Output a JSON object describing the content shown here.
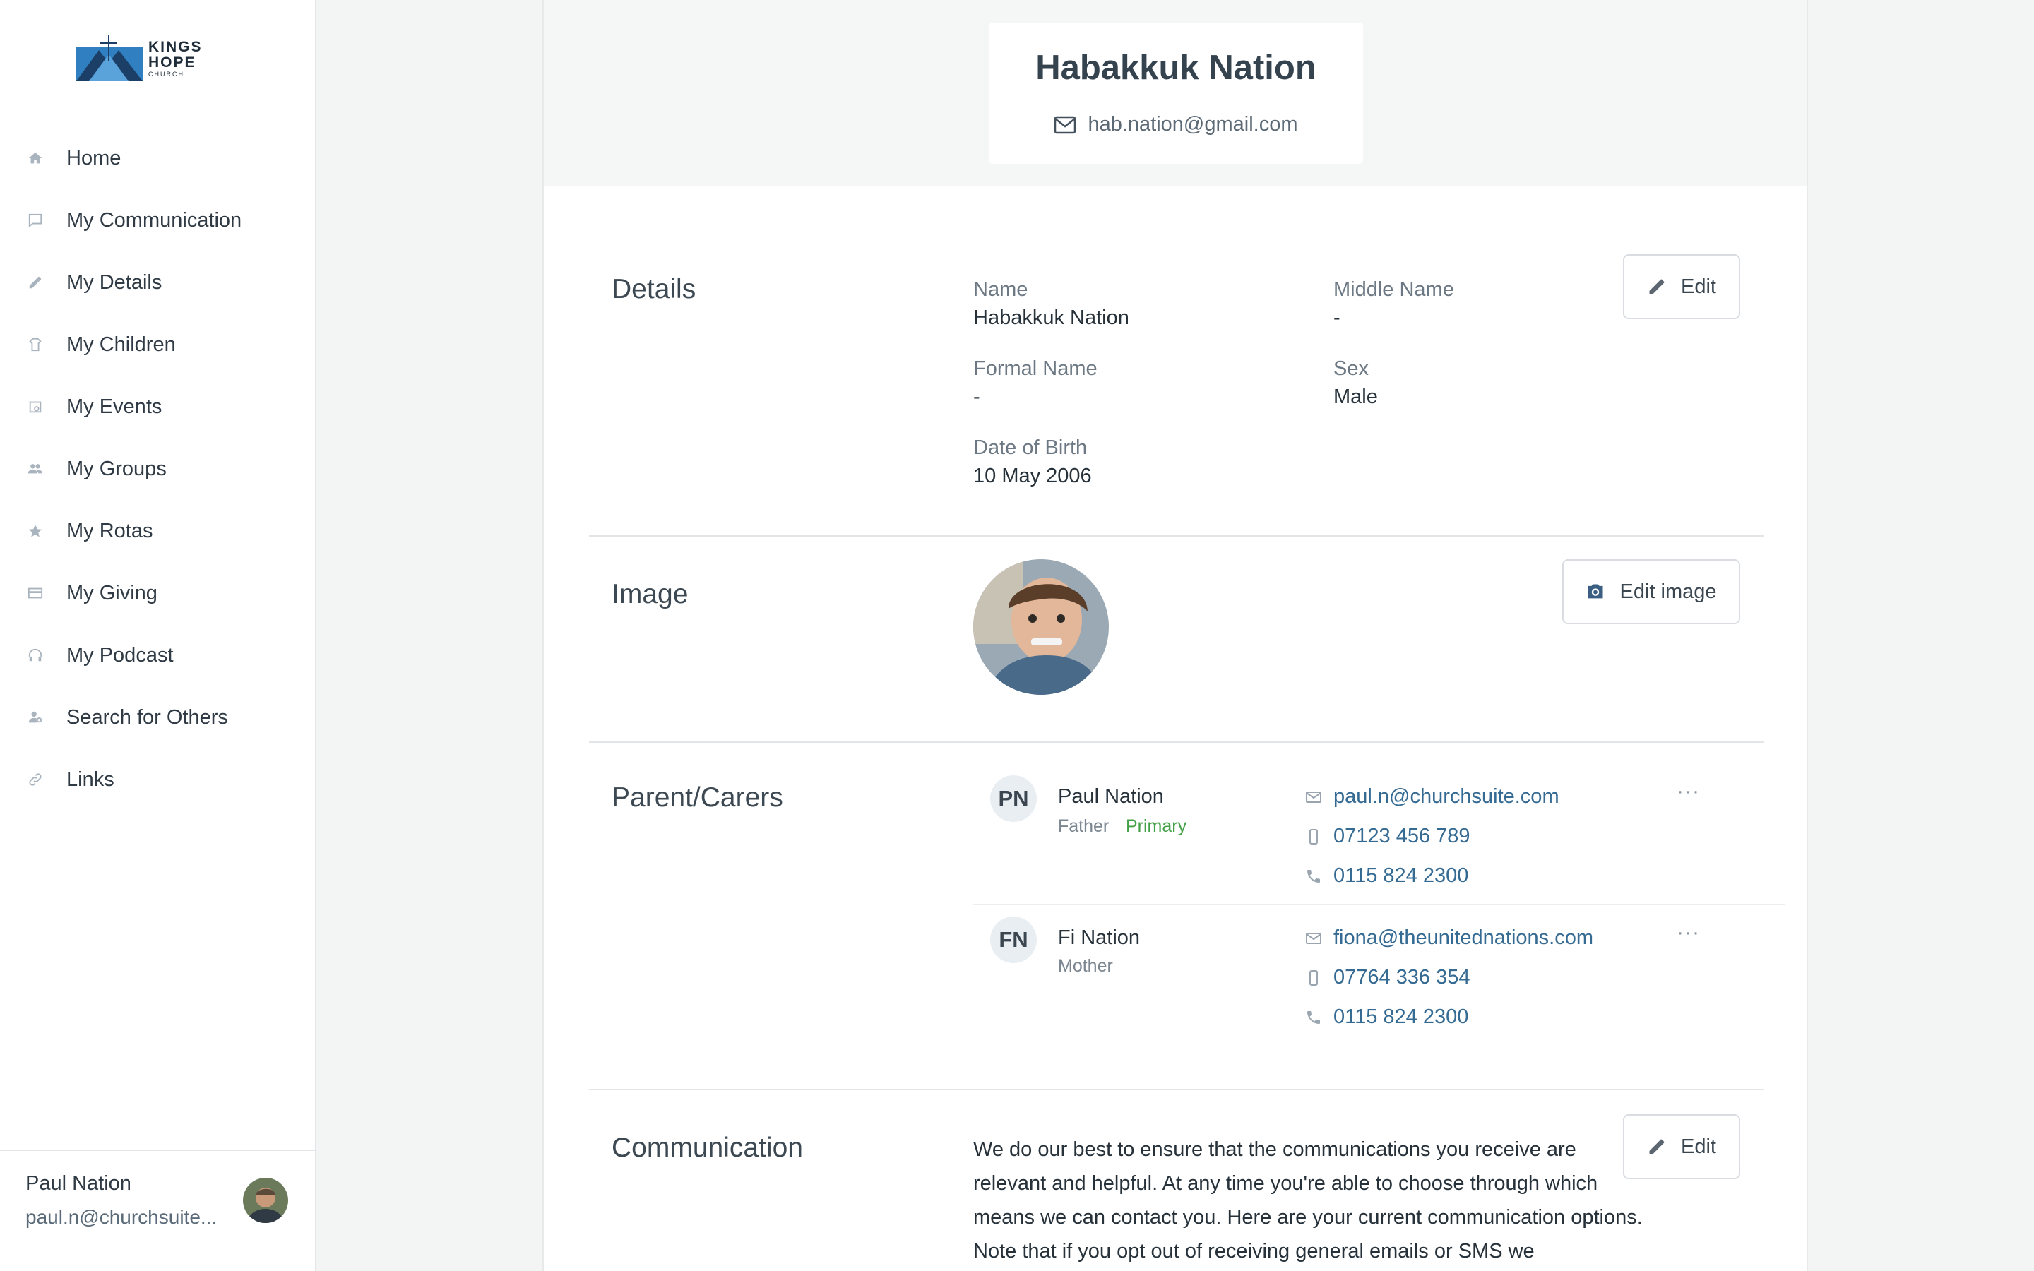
{
  "brand": {
    "name": "KINGS HOPE",
    "sub": "CHURCH"
  },
  "sidebar": {
    "items": [
      {
        "label": "Home",
        "icon": "home-icon"
      },
      {
        "label": "My Communication",
        "icon": "chat-icon"
      },
      {
        "label": "My Details",
        "icon": "pencil-icon"
      },
      {
        "label": "My Children",
        "icon": "child-icon"
      },
      {
        "label": "My Events",
        "icon": "calendar-icon"
      },
      {
        "label": "My Groups",
        "icon": "group-icon"
      },
      {
        "label": "My Rotas",
        "icon": "star-icon"
      },
      {
        "label": "My Giving",
        "icon": "card-icon"
      },
      {
        "label": "My Podcast",
        "icon": "headphones-icon"
      },
      {
        "label": "Search for Others",
        "icon": "person-search-icon"
      },
      {
        "label": "Links",
        "icon": "link-icon"
      }
    ],
    "user": {
      "name": "Paul Nation",
      "email": "paul.n@churchsuite..."
    }
  },
  "profile": {
    "name": "Habakkuk Nation",
    "email": "hab.nation@gmail.com"
  },
  "details": {
    "title": "Details",
    "edit_label": "Edit",
    "name_label": "Name",
    "name_value": "Habakkuk Nation",
    "middle_label": "Middle Name",
    "middle_value": "-",
    "formal_label": "Formal Name",
    "formal_value": "-",
    "sex_label": "Sex",
    "sex_value": "Male",
    "dob_label": "Date of Birth",
    "dob_value": "10 May 2006"
  },
  "image": {
    "title": "Image",
    "edit_label": "Edit image"
  },
  "parents": {
    "title": "Parent/Carers",
    "items": [
      {
        "initials": "PN",
        "name": "Paul Nation",
        "relation": "Father",
        "primary": "Primary",
        "email": "paul.n@churchsuite.com",
        "mobile": "07123 456 789",
        "phone": "0115 824 2300"
      },
      {
        "initials": "FN",
        "name": "Fi Nation",
        "relation": "Mother",
        "primary": "",
        "email": "fiona@theunitednations.com",
        "mobile": "07764 336 354",
        "phone": "0115 824 2300"
      }
    ],
    "more_label": "···"
  },
  "communication": {
    "title": "Communication",
    "edit_label": "Edit",
    "text": "We do our best to ensure that the communications you receive are relevant and helpful. At any time you're able to choose through which means we can contact you. Here are your current communication options. Note that if you opt out of receiving general emails or SMS we"
  },
  "colors": {
    "link": "#356a93",
    "primary_badge": "#43a047",
    "icon_muted": "#a9b4be"
  }
}
